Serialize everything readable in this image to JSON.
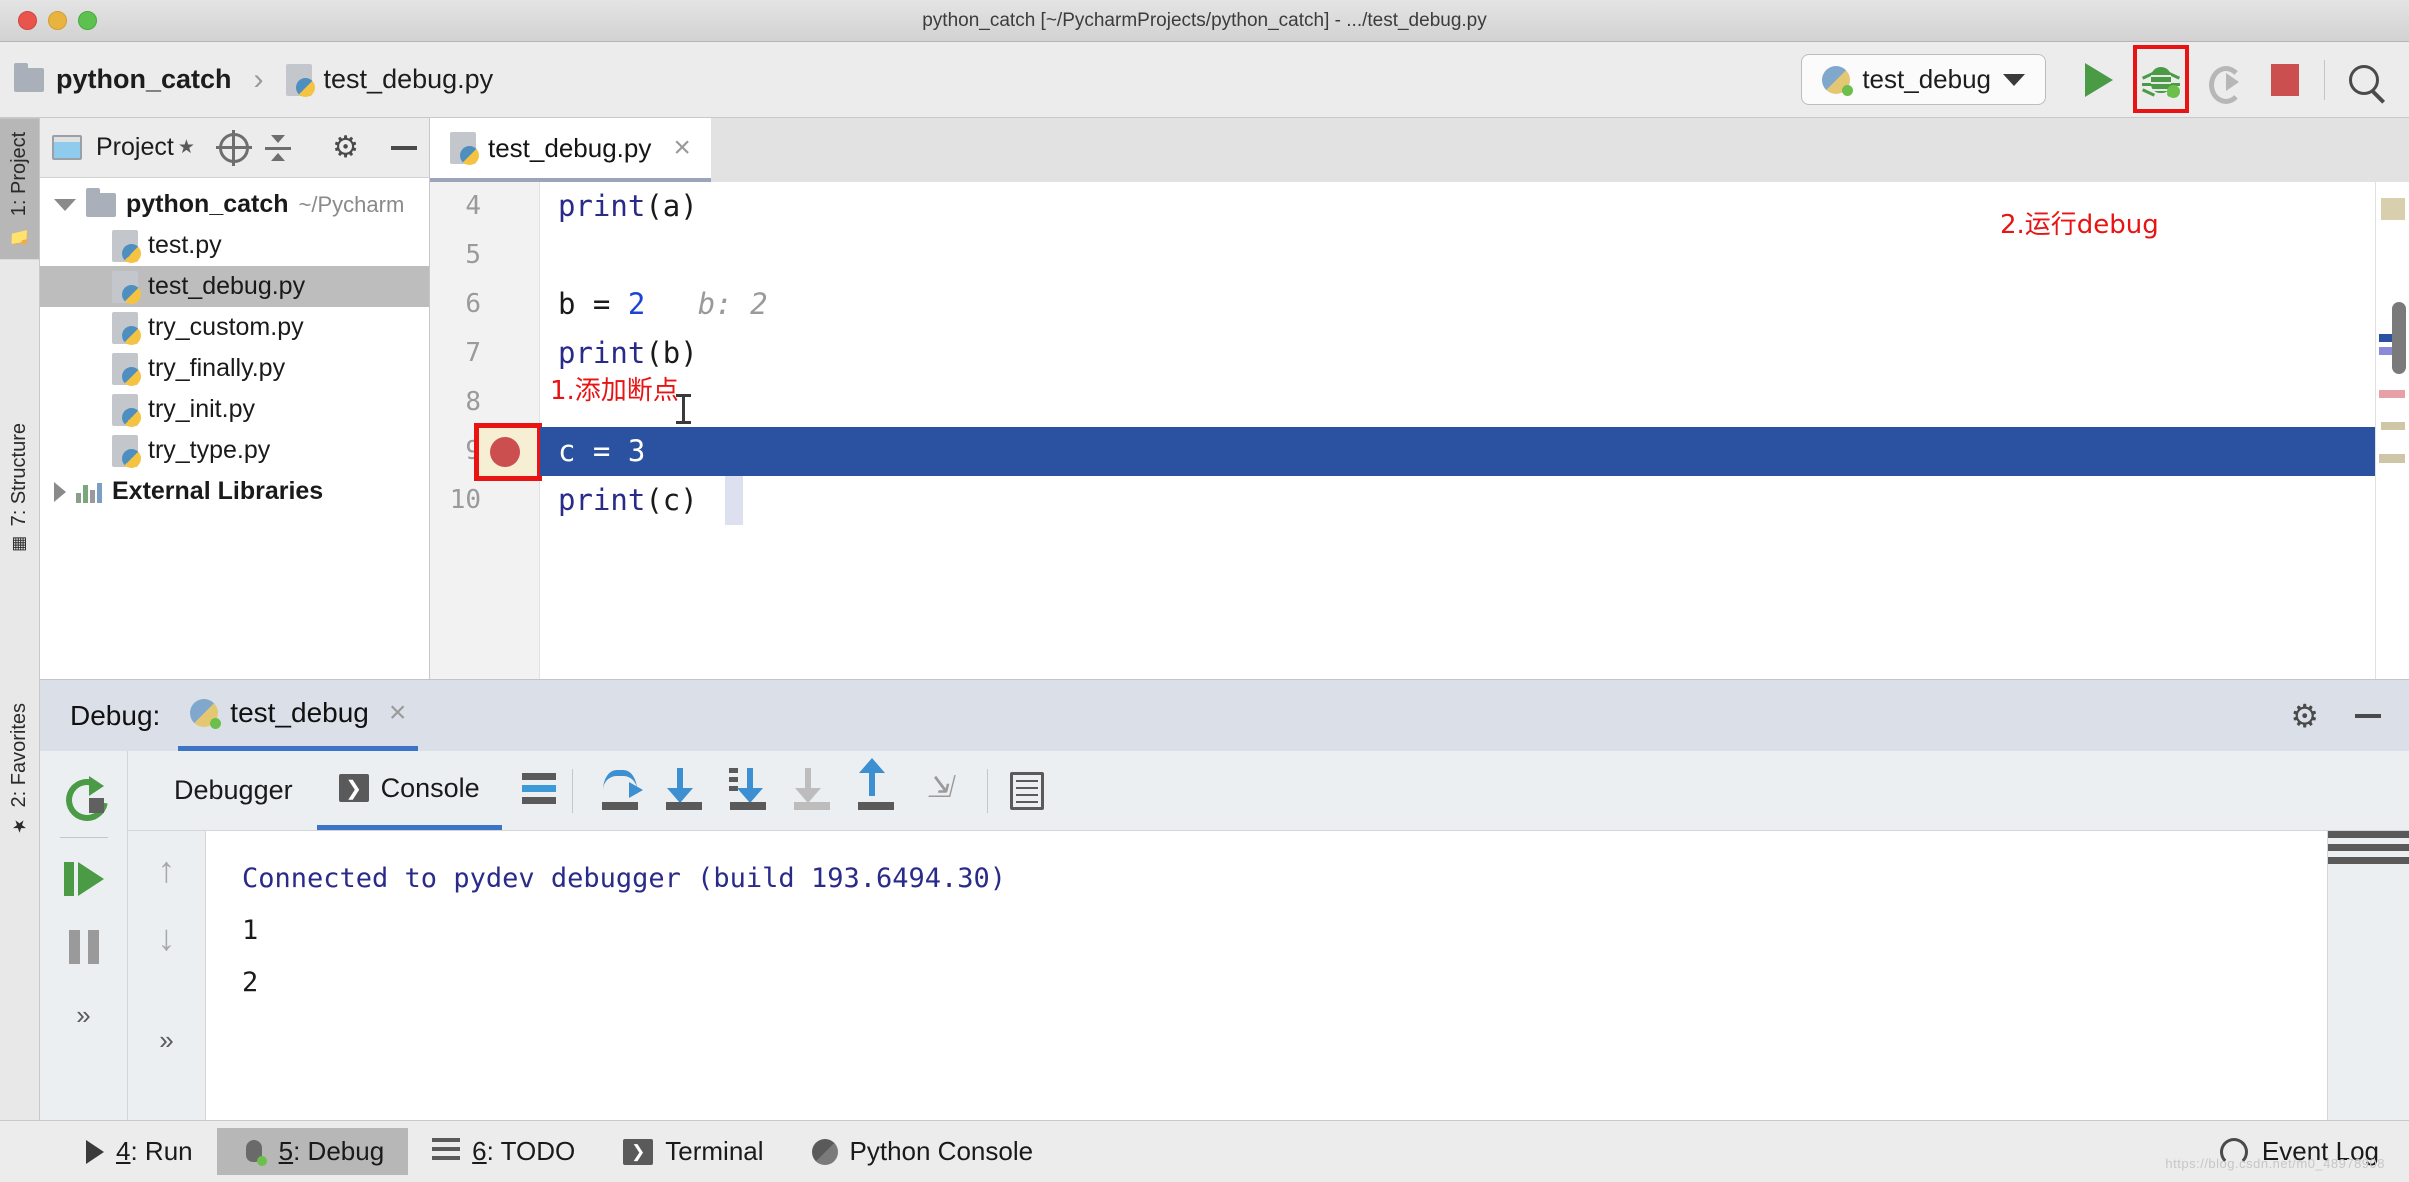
{
  "window": {
    "title": "python_catch [~/PycharmProjects/python_catch] - .../test_debug.py"
  },
  "breadcrumb": {
    "project": "python_catch",
    "separator": "›",
    "file": "test_debug.py"
  },
  "toolbar": {
    "run_config": "test_debug",
    "run_icon": "run-play-icon",
    "debug_icon": "debug-bug-icon",
    "rerun_icon": "rerun-icon",
    "stop_icon": "stop-icon",
    "search_icon": "search-icon",
    "annotation_debug": "2.运行debug",
    "highlight_color": "#e81414"
  },
  "left_strip": {
    "tabs": [
      {
        "label": "1: Project",
        "active": true
      },
      {
        "label": "7: Structure",
        "active": false
      },
      {
        "label": "2: Favorites",
        "active": false
      }
    ]
  },
  "project_panel": {
    "title": "Project",
    "icons": [
      "project-window-icon",
      "star-icon",
      "locate-target-icon",
      "collapse-all-icon",
      "gear-icon",
      "minimize-icon"
    ],
    "tree": {
      "root": {
        "label": "python_catch",
        "path_hint": "~/Pycharm",
        "expanded": true
      },
      "files": [
        {
          "label": "test.py",
          "selected": false
        },
        {
          "label": "test_debug.py",
          "selected": true
        },
        {
          "label": "try_custom.py",
          "selected": false
        },
        {
          "label": "try_finally.py",
          "selected": false
        },
        {
          "label": "try_init.py",
          "selected": false
        },
        {
          "label": "try_type.py",
          "selected": false
        }
      ],
      "external": {
        "label": "External Libraries",
        "expanded": false
      }
    }
  },
  "editor": {
    "tab": {
      "label": "test_debug.py",
      "close": "×"
    },
    "annotation_breakpoint": "1.添加断点",
    "lines": [
      {
        "num": "4",
        "code": "print(a)",
        "kind": "call",
        "highlight": false,
        "breakpoint": false
      },
      {
        "num": "5",
        "code": "",
        "kind": "blank",
        "highlight": false,
        "breakpoint": false
      },
      {
        "num": "6",
        "code": "b = 2",
        "kind": "assign",
        "highlight": false,
        "breakpoint": false,
        "inline_hint": "b: 2"
      },
      {
        "num": "7",
        "code": "print(b)",
        "kind": "call",
        "highlight": false,
        "breakpoint": false
      },
      {
        "num": "8",
        "code": "",
        "kind": "blank",
        "highlight": false,
        "breakpoint": false
      },
      {
        "num": "9",
        "code": "c = 3",
        "kind": "assign",
        "highlight": true,
        "breakpoint": true
      },
      {
        "num": "10",
        "code": "print(c)",
        "kind": "call",
        "highlight": false,
        "breakpoint": false
      }
    ]
  },
  "debug_window": {
    "label": "Debug:",
    "session_tab": "test_debug",
    "close": "×",
    "gear_icon": "gear-icon",
    "minimize_icon": "minimize-icon",
    "left_controls": [
      "rerun-icon",
      "resume-program-icon",
      "pause-program-icon",
      "more-icon"
    ],
    "tabs": [
      {
        "label": "Debugger",
        "active": false
      },
      {
        "label": "Console",
        "active": true
      }
    ],
    "step_buttons": [
      "show-execution-point-icon",
      "step-over-icon",
      "step-into-icon",
      "force-step-into-icon",
      "step-out-icon",
      "run-to-cursor-icon",
      "evaluate-expression-icon"
    ],
    "side_controls": [
      "scroll-up-icon",
      "scroll-down-icon",
      "more-icon"
    ],
    "console_output": [
      {
        "text": "Connected to pydev debugger (build 193.6494.30)",
        "style": "info"
      },
      {
        "text": "1",
        "style": "normal"
      },
      {
        "text": "2",
        "style": "normal"
      }
    ]
  },
  "statusbar": {
    "items": [
      {
        "num": "4",
        "label": ": Run",
        "icon": "run-icon",
        "active": false
      },
      {
        "num": "5",
        "label": ": Debug",
        "icon": "bug-icon",
        "active": true
      },
      {
        "num": "6",
        "label": ": TODO",
        "icon": "list-icon",
        "active": false
      }
    ],
    "terminal": "Terminal",
    "python_console": "Python Console",
    "event_log": "Event Log",
    "watermark": "https://blog.csdn.net/m0_48978908"
  }
}
